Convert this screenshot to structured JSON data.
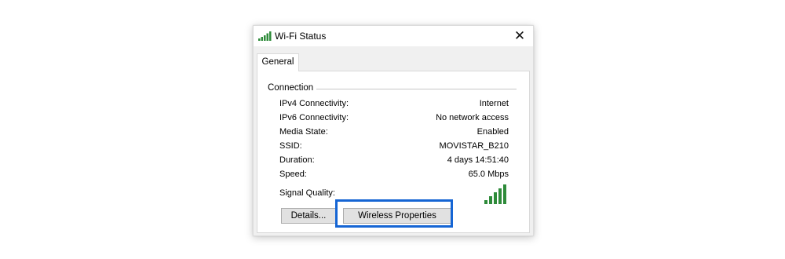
{
  "window": {
    "title": "Wi-Fi Status",
    "title_icon": "wifi-signal-icon",
    "close_glyph": "✕"
  },
  "tabs": [
    {
      "label": "General",
      "selected": true
    }
  ],
  "connection": {
    "group_label": "Connection",
    "rows": [
      {
        "label": "IPv4 Connectivity:",
        "value": "Internet"
      },
      {
        "label": "IPv6 Connectivity:",
        "value": "No network access"
      },
      {
        "label": "Media State:",
        "value": "Enabled"
      },
      {
        "label": "SSID:",
        "value": "MOVISTAR_B210"
      },
      {
        "label": "Duration:",
        "value": "4 days 14:51:40"
      },
      {
        "label": "Speed:",
        "value": "65.0 Mbps"
      }
    ],
    "signal_quality_label": "Signal Quality:",
    "signal_bars": 5,
    "signal_bars_max": 5
  },
  "buttons": {
    "details_label": "Details...",
    "wireless_properties_label": "Wireless Properties"
  },
  "colors": {
    "signal_green": "#2e8b3a",
    "highlight_blue": "#1565d4"
  }
}
